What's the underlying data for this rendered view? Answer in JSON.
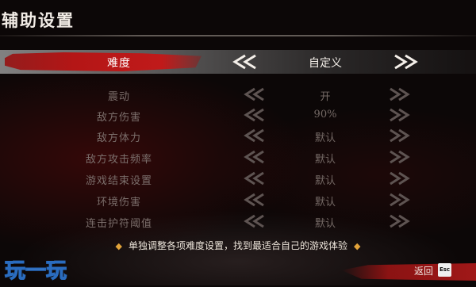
{
  "title": "辅助设置",
  "rows": [
    {
      "label": "难度",
      "value": "自定义",
      "selected": true
    },
    {
      "label": "震动",
      "value": "开",
      "selected": false
    },
    {
      "label": "敌方伤害",
      "value": "90%",
      "selected": false
    },
    {
      "label": "敌方体力",
      "value": "默认",
      "selected": false
    },
    {
      "label": "敌方攻击频率",
      "value": "默认",
      "selected": false
    },
    {
      "label": "游戏结束设置",
      "value": "默认",
      "selected": false
    },
    {
      "label": "环境伤害",
      "value": "默认",
      "selected": false
    },
    {
      "label": "连击护符阈值",
      "value": "默认",
      "selected": false
    }
  ],
  "hint": "单独调整各项难度设置，找到最适合自己的游戏体验",
  "back_label": "返回",
  "esc_label": "Esc",
  "watermark": "玩一玩",
  "colors": {
    "accent_red": "#b41616",
    "hint_diamond": "#e2a33a",
    "text_dim": "#7b6e6b",
    "text_bright": "#f4efe9"
  },
  "icons": {
    "left": "double-chevron-left-icon",
    "right": "double-chevron-right-icon"
  }
}
